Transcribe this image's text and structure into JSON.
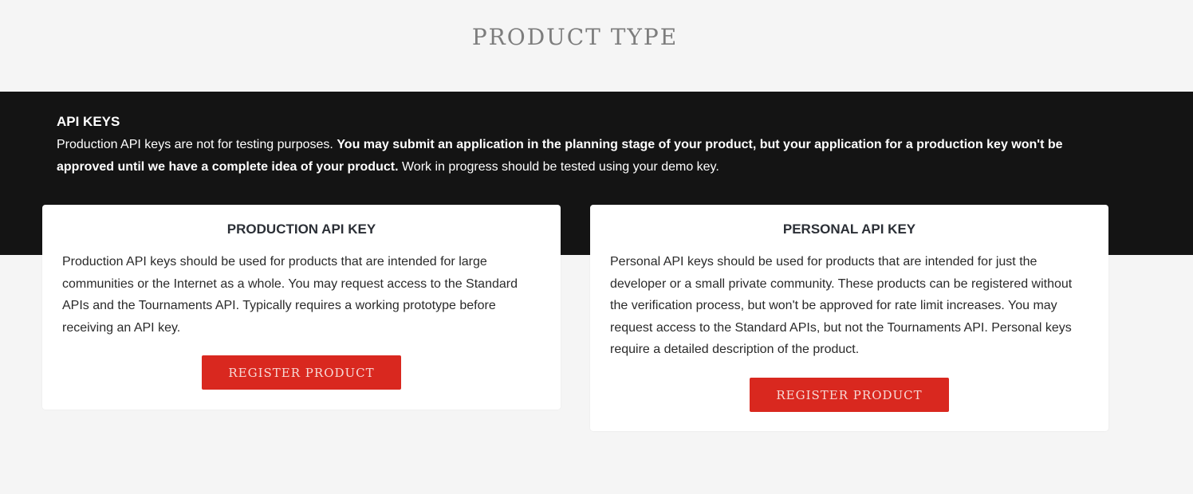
{
  "page": {
    "title": "PRODUCT TYPE"
  },
  "info": {
    "title": "API KEYS",
    "text_part1": "Production API keys are not for testing purposes. ",
    "text_bold": "You may submit an application in the planning stage of your product, but your application for a production key won't be approved until we have a complete idea of your product.",
    "text_part2": " Work in progress should be tested using your demo key."
  },
  "cards": [
    {
      "title": "PRODUCTION API KEY",
      "description": "Production API keys should be used for products that are intended for large communities or the Internet as a whole. You may request access to the Standard APIs and the Tournaments API. Typically requires a working prototype before receiving an API key.",
      "button_label": "REGISTER PRODUCT"
    },
    {
      "title": "PERSONAL API KEY",
      "description": "Personal API keys should be used for products that are intended for just the developer or a small private community. These products can be registered without the verification process, but won't be approved for rate limit increases. You may request access to the Standard APIs, but not the Tournaments API. Personal keys require a detailed description of the product.",
      "button_label": "REGISTER PRODUCT"
    }
  ],
  "colors": {
    "background": "#f5f5f5",
    "dark_band": "#141414",
    "button": "#d9281f",
    "title_gray": "#7d7d7d"
  }
}
